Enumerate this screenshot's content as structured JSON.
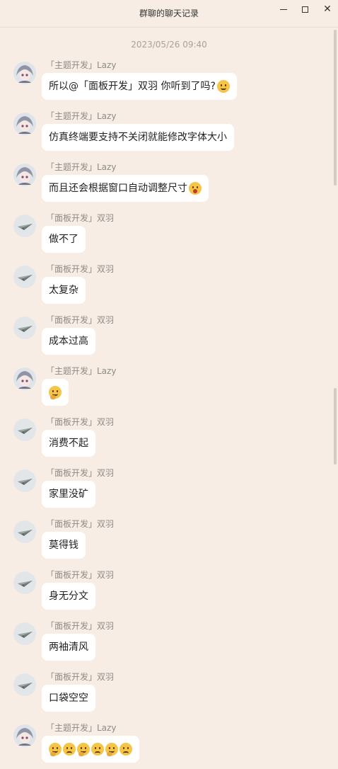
{
  "window": {
    "title": "群聊的聊天记录",
    "minimize_icon": "minimize-icon",
    "maximize_icon": "maximize-icon",
    "close_icon": "close-icon",
    "close_glyph": "✕"
  },
  "timestamp": "2023/05/26 09:40",
  "messages": [
    {
      "sender": "「主题开发」Lazy",
      "avatar": "anime-girl-avatar",
      "text": "所以@「面板开发」双羽 你听到了吗?",
      "emojis": [
        "smile"
      ]
    },
    {
      "sender": "「主题开发」Lazy",
      "avatar": "anime-girl-avatar",
      "text": "仿真终端要支持不关闭就能修改字体大小",
      "emojis": []
    },
    {
      "sender": "「主题开发」Lazy",
      "avatar": "anime-girl-avatar",
      "text": "而且还会根据窗口自动调整尺寸",
      "emojis": [
        "shock"
      ]
    },
    {
      "sender": "「面板开发」双羽",
      "avatar": "paper-plane-avatar",
      "text": "做不了",
      "emojis": []
    },
    {
      "sender": "「面板开发」双羽",
      "avatar": "paper-plane-avatar",
      "text": "太复杂",
      "emojis": []
    },
    {
      "sender": "「面板开发」双羽",
      "avatar": "paper-plane-avatar",
      "text": "成本过高",
      "emojis": []
    },
    {
      "sender": "「主题开发」Lazy",
      "avatar": "anime-girl-avatar",
      "text": "",
      "emojis": [
        "think"
      ]
    },
    {
      "sender": "「面板开发」双羽",
      "avatar": "paper-plane-avatar",
      "text": "消费不起",
      "emojis": []
    },
    {
      "sender": "「面板开发」双羽",
      "avatar": "paper-plane-avatar",
      "text": "家里没矿",
      "emojis": []
    },
    {
      "sender": "「面板开发」双羽",
      "avatar": "paper-plane-avatar",
      "text": "莫得钱",
      "emojis": []
    },
    {
      "sender": "「面板开发」双羽",
      "avatar": "paper-plane-avatar",
      "text": "身无分文",
      "emojis": []
    },
    {
      "sender": "「面板开发」双羽",
      "avatar": "paper-plane-avatar",
      "text": "两袖清风",
      "emojis": []
    },
    {
      "sender": "「面板开发」双羽",
      "avatar": "paper-plane-avatar",
      "text": "口袋空空",
      "emojis": []
    },
    {
      "sender": "「主题开发」Lazy",
      "avatar": "anime-girl-avatar",
      "text": "",
      "emojis": [
        "think",
        "frown",
        "think",
        "frown",
        "think",
        "frown"
      ]
    }
  ],
  "colors": {
    "background": "#f7ede4",
    "bubble": "#ffffff",
    "sender_text": "#8f8a86",
    "timestamp_text": "#a9a19a"
  }
}
